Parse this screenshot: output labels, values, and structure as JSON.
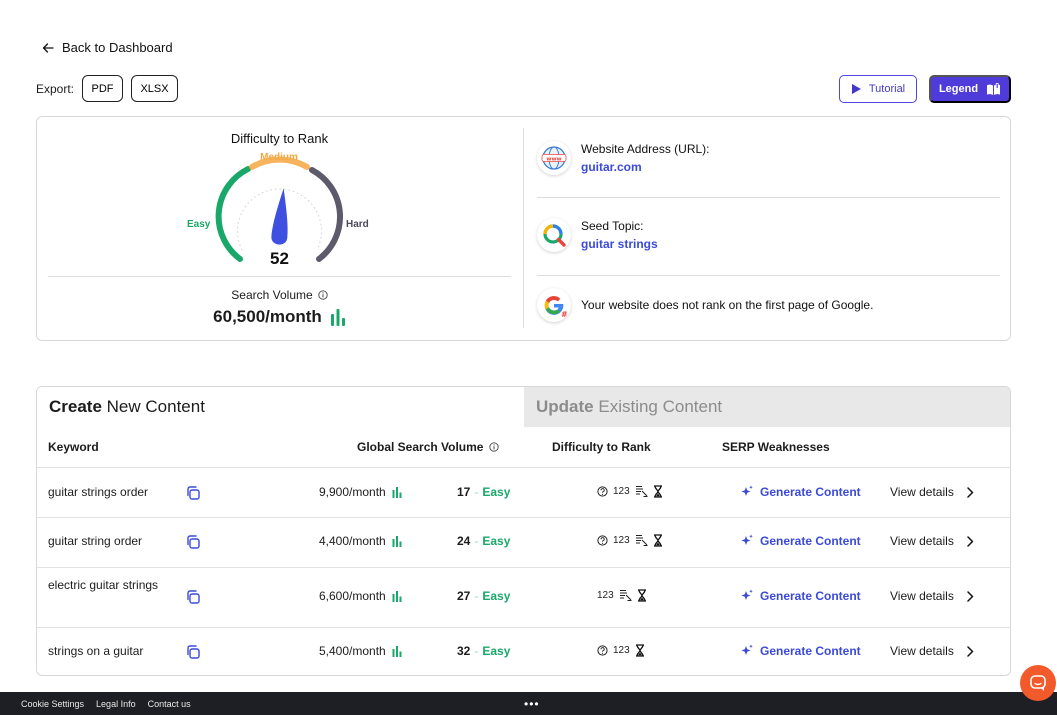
{
  "nav": {
    "back_label": "Back to Dashboard"
  },
  "export": {
    "label": "Export:",
    "pdf": "PDF",
    "xlsx": "XLSX"
  },
  "actions": {
    "tutorial": "Tutorial",
    "legend": "Legend"
  },
  "gauge": {
    "title": "Difficulty to Rank",
    "value": "52",
    "value_num": 52,
    "scale_max": 100,
    "labels": {
      "easy": "Easy",
      "medium": "Medium",
      "hard": "Hard"
    },
    "colors": {
      "easy": "#1aa86a",
      "medium": "#f5a742",
      "hard": "#4b4b5a",
      "needle": "#3f4fe0"
    }
  },
  "search_volume": {
    "label": "Search Volume",
    "value": "60,500/month"
  },
  "info": {
    "website_label": "Website Address (URL):",
    "website_value": "guitar.com",
    "seed_label": "Seed Topic:",
    "seed_value": "guitar strings",
    "google_note": "Your website does not rank on the first page of Google."
  },
  "tabs": {
    "create_bold": "Create",
    "create_rest": "New Content",
    "update_bold": "Update",
    "update_rest": "Existing Content"
  },
  "columns": {
    "keyword": "Keyword",
    "volume": "Global Search Volume",
    "difficulty": "Difficulty to Rank",
    "serp": "SERP Weaknesses"
  },
  "rows": [
    {
      "keyword": "guitar strings order",
      "volume": "9,900/month",
      "difficulty": "17",
      "level": "Easy",
      "serp_code": "123",
      "generate": "Generate Content",
      "view": "View details"
    },
    {
      "keyword": "guitar string order",
      "volume": "4,400/month",
      "difficulty": "24",
      "level": "Easy",
      "serp_code": "123",
      "generate": "Generate Content",
      "view": "View details"
    },
    {
      "keyword": "electric guitar strings",
      "volume": "6,600/month",
      "difficulty": "27",
      "level": "Easy",
      "serp_code": "123",
      "generate": "Generate Content",
      "view": "View details"
    },
    {
      "keyword": "strings on a guitar",
      "volume": "5,400/month",
      "difficulty": "32",
      "level": "Easy",
      "serp_code": "123",
      "generate": "Generate Content",
      "view": "View details"
    }
  ],
  "footer": {
    "cookie": "Cookie Settings",
    "legal": "Legal Info",
    "contact": "Contact us",
    "dots": "•••"
  },
  "brand": {
    "accent": "#4f3bd9",
    "link": "#3b4ad8",
    "easy": "#1aa86a",
    "chat": "#f25a2c"
  }
}
